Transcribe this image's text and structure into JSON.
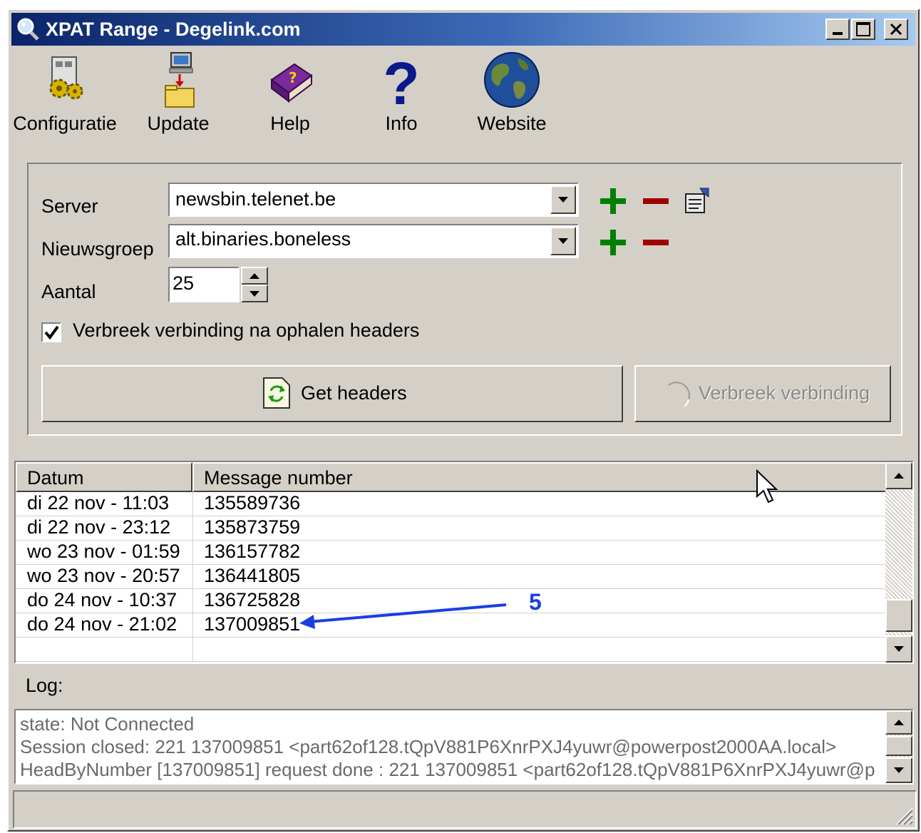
{
  "window": {
    "title": "XPAT Range - Degelink.com"
  },
  "toolbar": [
    {
      "label": "Configuratie",
      "icon": "config-gears-icon"
    },
    {
      "label": "Update",
      "icon": "update-computer-folder-icon"
    },
    {
      "label": "Help",
      "icon": "help-book-icon"
    },
    {
      "label": "Info",
      "icon": "question-mark-icon"
    },
    {
      "label": "Website",
      "icon": "globe-icon"
    }
  ],
  "form": {
    "server_label": "Server",
    "server_value": "newsbin.telenet.be",
    "newsgroup_label": "Nieuwsgroep",
    "newsgroup_value": "alt.binaries.boneless",
    "count_label": "Aantal",
    "count_value": "25",
    "disconnect_checkbox_label": "Verbreek verbinding na ophalen headers",
    "disconnect_checked": true,
    "get_headers_label": "Get headers",
    "disconnect_button_label": "Verbreek verbinding"
  },
  "list": {
    "columns": [
      "Datum",
      "Message number"
    ],
    "rows": [
      {
        "date": "di 22 nov - 11:03",
        "number": "135589736"
      },
      {
        "date": "di 22 nov - 23:12",
        "number": "135873759"
      },
      {
        "date": "wo 23 nov - 01:59",
        "number": "136157782"
      },
      {
        "date": "wo 23 nov - 20:57",
        "number": "136441805"
      },
      {
        "date": "do 24 nov - 10:37",
        "number": "136725828"
      },
      {
        "date": "do 24 nov - 21:02",
        "number": "137009851"
      }
    ],
    "annotation": "5"
  },
  "log": {
    "label": "Log:",
    "lines": [
      "state: Not Connected",
      "Session closed: 221 137009851 <part62of128.tQpV881P6XnrPXJ4yuwr@powerpost2000AA.local>",
      "HeadByNumber [137009851] request done : 221 137009851 <part62of128.tQpV881P6XnrPXJ4yuwr@p"
    ]
  },
  "colors": {
    "title_start": "#0a246a",
    "title_end": "#a6caf0",
    "add": "#008000",
    "remove": "#a00000",
    "annotation": "#1a3ee6"
  }
}
